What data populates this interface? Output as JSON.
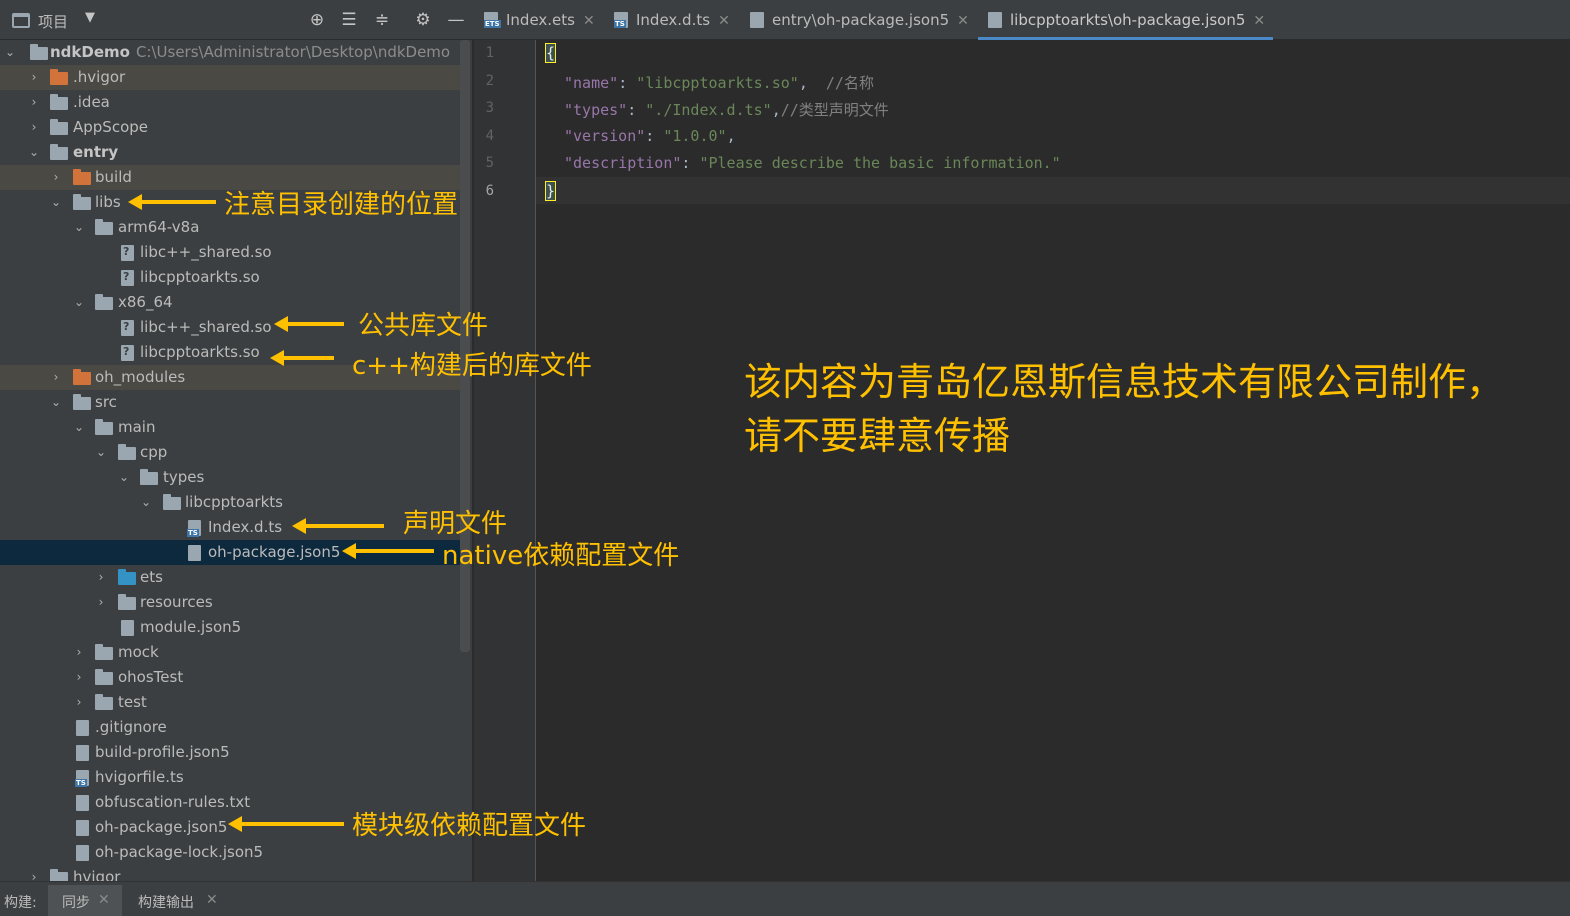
{
  "toolbar": {
    "project_label": "项目",
    "icons": [
      "locate-icon",
      "expand-all-icon",
      "collapse-all-icon",
      "settings-icon",
      "minimize-icon"
    ]
  },
  "tabs": [
    {
      "label": "Index.ets",
      "icon": "ets-file-icon"
    },
    {
      "label": "Index.d.ts",
      "icon": "ts-file-icon"
    },
    {
      "label": "entry\\oh-package.json5",
      "icon": "json5-file-icon"
    },
    {
      "label": "libcpptoarkts\\oh-package.json5",
      "icon": "json5-file-icon",
      "active": true
    }
  ],
  "tree": {
    "root_name": "ndkDemo",
    "root_path": "C:\\Users\\Administrator\\Desktop\\ndkDemo",
    "items": [
      {
        "label": ".hvigor"
      },
      {
        "label": ".idea"
      },
      {
        "label": "AppScope"
      },
      {
        "label": "entry"
      },
      {
        "label": "build"
      },
      {
        "label": "libs"
      },
      {
        "label": "arm64-v8a"
      },
      {
        "label": "libc++_shared.so"
      },
      {
        "label": "libcpptoarkts.so"
      },
      {
        "label": "x86_64"
      },
      {
        "label": "libc++_shared.so"
      },
      {
        "label": "libcpptoarkts.so"
      },
      {
        "label": "oh_modules"
      },
      {
        "label": "src"
      },
      {
        "label": "main"
      },
      {
        "label": "cpp"
      },
      {
        "label": "types"
      },
      {
        "label": "libcpptoarkts"
      },
      {
        "label": "Index.d.ts"
      },
      {
        "label": "oh-package.json5"
      },
      {
        "label": "ets"
      },
      {
        "label": "resources"
      },
      {
        "label": "module.json5"
      },
      {
        "label": "mock"
      },
      {
        "label": "ohosTest"
      },
      {
        "label": "test"
      },
      {
        "label": ".gitignore"
      },
      {
        "label": "build-profile.json5"
      },
      {
        "label": "hvigorfile.ts"
      },
      {
        "label": "obfuscation-rules.txt"
      },
      {
        "label": "oh-package.json5"
      },
      {
        "label": "oh-package-lock.json5"
      },
      {
        "label": "hvigor"
      }
    ]
  },
  "editor": {
    "line_numbers": [
      "1",
      "2",
      "3",
      "4",
      "5",
      "6"
    ],
    "lines": {
      "l1": "{",
      "l2_key": "\"name\"",
      "l2_colon": ": ",
      "l2_val": "\"libcpptoarkts.so\"",
      "l2_rest": ",  ",
      "l2_comment": "//名称",
      "l3_key": "\"types\"",
      "l3_colon": ": ",
      "l3_val": "\"./Index.d.ts\"",
      "l3_rest": ",",
      "l3_comment": "//类型声明文件",
      "l4_key": "\"version\"",
      "l4_colon": ": ",
      "l4_val": "\"1.0.0\"",
      "l4_rest": ",",
      "l5_key": "\"description\"",
      "l5_colon": ": ",
      "l5_val": "\"Please describe the basic information.\"",
      "l6": "}"
    }
  },
  "annotations": {
    "libs_note": "注意目录创建的位置",
    "shared_lib_note": "公共库文件",
    "built_lib_note": "c++构建后的库文件",
    "decl_note": "声明文件",
    "native_dep_note": "native依赖配置文件",
    "module_dep_note": "模块级依赖配置文件",
    "watermark_line1": "该内容为青岛亿恩斯信息技术有限公司制作，",
    "watermark_line2": "请不要肆意传播"
  },
  "bottom": {
    "build_label": "构建:",
    "sync_label": "同步",
    "build_output_label": "构建输出"
  },
  "colors": {
    "annotation": "#ffc000",
    "selection": "#0d293e",
    "tab_underline": "#4a88c7"
  }
}
